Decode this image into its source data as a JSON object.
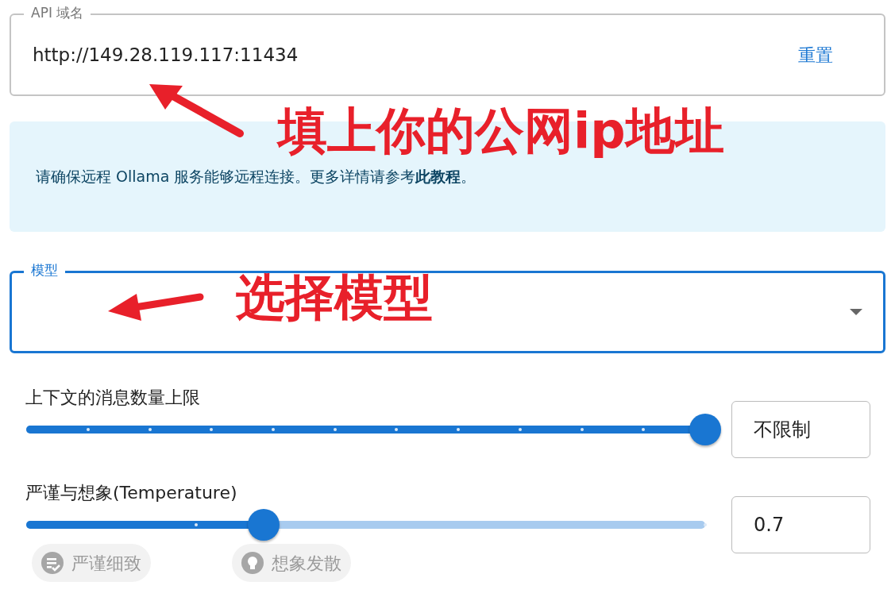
{
  "api_field": {
    "label": "API 域名",
    "value": "http://149.28.119.117:11434",
    "reset": "重置"
  },
  "info": {
    "text": "请确保远程 Ollama 服务能够远程连接。更多详情请参考**此教程**。"
  },
  "model_field": {
    "label": "模型",
    "focused": true
  },
  "sliders": [
    {
      "label": "上下文的消息数量上限",
      "level": 1,
      "value": "不限制"
    },
    {
      "label": "严谨与想象(Temperature)",
      "level": 0.35,
      "value": "0.7"
    }
  ],
  "chips": [
    {
      "label": "严谨细致",
      "kind": "checklist"
    },
    {
      "label": "想象发散",
      "kind": "bulb"
    }
  ],
  "annotations": [
    {
      "text": "填上你的公网ip地址"
    },
    {
      "text": "选择模型"
    }
  ]
}
